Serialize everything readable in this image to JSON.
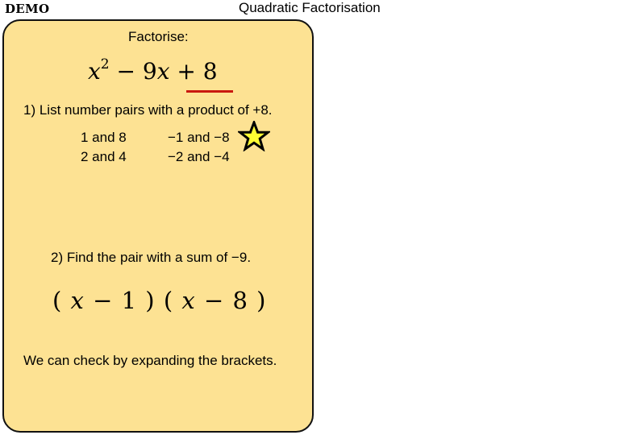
{
  "header": {
    "demo_label": "DEMO",
    "title": "Quadratic Factorisation"
  },
  "card": {
    "background_color": "#fde293",
    "prompt": "Factorise:",
    "expression": {
      "var": "x",
      "exponent": "2",
      "middle": " − 9",
      "middle_var": "x",
      "tail": " + 8"
    },
    "highlight_color": "#c9180f",
    "step1": "1) List number pairs with a product of +8.",
    "pairs": [
      "1  and 8",
      "2  and 4",
      "−1  and −8",
      "−2  and −4"
    ],
    "marked_pair_icon": "star-icon",
    "star_fill": "#ffff33",
    "step2": "2) Find the pair with a sum of −9.",
    "answer": {
      "open1": "( ",
      "var1": "x",
      "rest1": " − 1  ) ( ",
      "var2": "x",
      "rest2": "  − 8  )"
    },
    "check_text": "We can check by expanding the brackets."
  }
}
